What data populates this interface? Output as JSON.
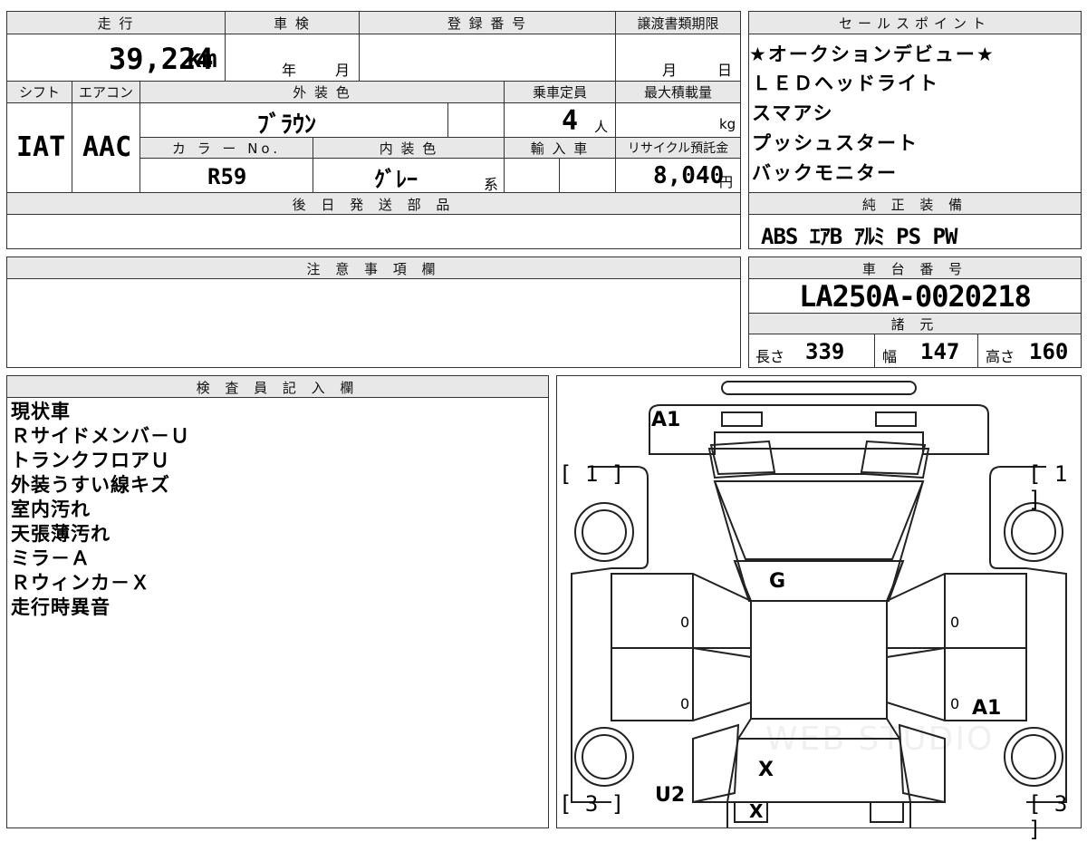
{
  "main": {
    "mileage_label": "走 行",
    "mileage_value": "39,224",
    "mileage_unit": "km",
    "inspection_label": "車 検",
    "inspection_year": "年",
    "inspection_month": "月",
    "registration_label": "登 録 番 号",
    "transfer_label": "譲渡書類期限",
    "transfer_month": "月",
    "transfer_day": "日",
    "shift_label": "シフト",
    "ac_label": "エアコン",
    "exterior_label": "外 装 色",
    "capacity_label": "乗車定員",
    "load_label": "最大積載量",
    "shift_value": "IAT",
    "ac_value": "AAC",
    "exterior_value": "ﾌﾞﾗｳﾝ",
    "capacity_value": "4",
    "capacity_unit": "人",
    "load_unit": "kg",
    "color_no_label": "カ ラ ー No.",
    "interior_label": "内 装 色",
    "import_label": "輸 入 車",
    "recycle_label": "リサイクル預託金",
    "color_no_value": "R59",
    "interior_value": "ｸﾞﾚｰ",
    "interior_suffix": "系",
    "recycle_value": "8,040",
    "recycle_unit": "円",
    "parts_label": "後 日 発 送 部 品"
  },
  "sales": {
    "label": "セールスポイント",
    "points": [
      "★オークションデビュー★",
      "ＬＥＤヘッドライト",
      "スマアシ",
      "プッシュスタート",
      "バックモニター"
    ]
  },
  "equipment": {
    "label": "純 正 装 備",
    "value": "ABS ｴｱB ｱﾙﾐ PS PW"
  },
  "notes": {
    "label": "注 意 事 項 欄"
  },
  "chassis": {
    "label": "車 台 番 号",
    "value": "LA250A-0020218",
    "spec_label": "諸 元",
    "length_label": "長さ",
    "length_value": "339",
    "width_label": "幅",
    "width_value": "147",
    "height_label": "高さ",
    "height_value": "160"
  },
  "inspector": {
    "label": "検 査 員 記 入 欄",
    "items": [
      "現状車",
      "Ｒサイドメンバ－Ｕ",
      "トランクフロアＵ",
      "外装うすい線キズ",
      "室内汚れ",
      "天張薄汚れ",
      "ミラ－Ａ",
      "Ｒウィンカ－Ｘ",
      "走行時異音"
    ]
  },
  "diagram": {
    "marks": {
      "a1_top": "A1",
      "g": "G",
      "x_rear": "X",
      "x_bottom": "X",
      "u2": "U2",
      "a1_right": "A1",
      "zero_fl": "0",
      "zero_rl": "0",
      "zero_fr": "0",
      "zero_rr": "0"
    },
    "bracket_tl": "[ 1 ]",
    "bracket_tr": "[ 1 ]",
    "bracket_bl": "[ 3 ]",
    "bracket_br": "[ 3 ]",
    "watermark": "WEB STUDIO"
  }
}
